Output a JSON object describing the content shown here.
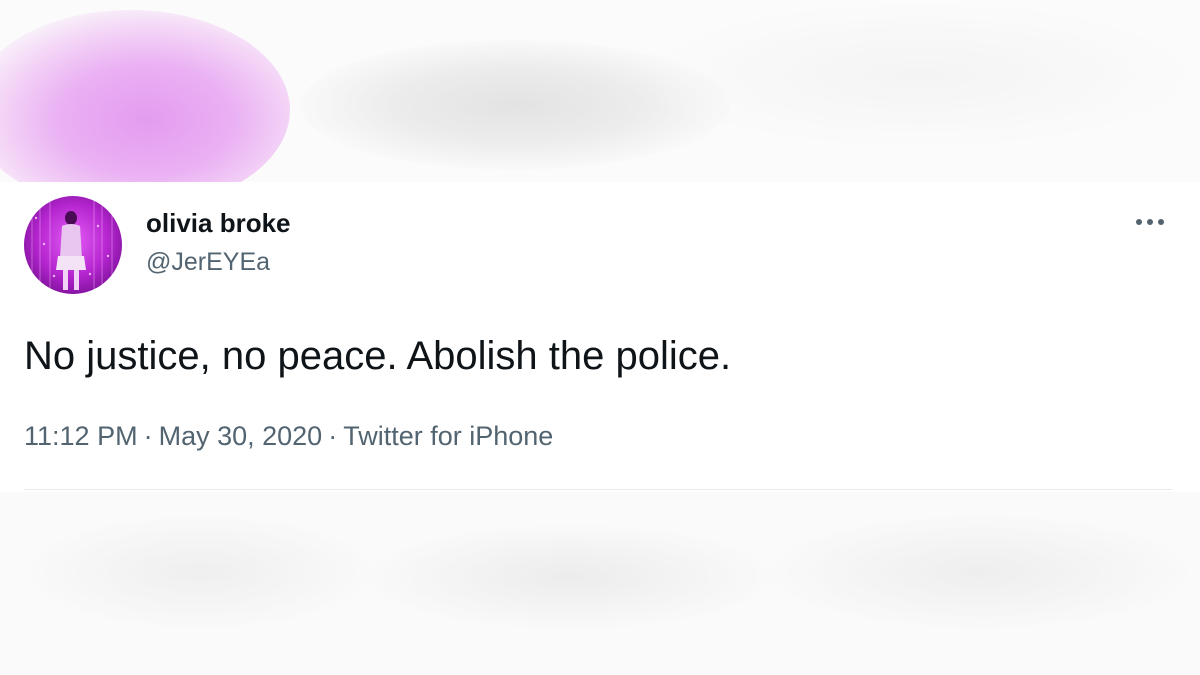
{
  "tweet": {
    "author": {
      "display_name": "olivia broke",
      "handle": "@JerEYEa",
      "avatar_icon": "profile-photo-purple"
    },
    "text": "No justice, no peace. Abolish the police.",
    "meta": {
      "time": "11:12 PM",
      "separator": "·",
      "date": "May 30, 2020",
      "source": "Twitter for iPhone"
    },
    "more_icon": "more-horizontal-icon"
  },
  "colors": {
    "text_primary": "#0f1419",
    "text_secondary": "#536471",
    "avatar_accent": "#c02bd6",
    "divider": "#e6ecf0"
  }
}
